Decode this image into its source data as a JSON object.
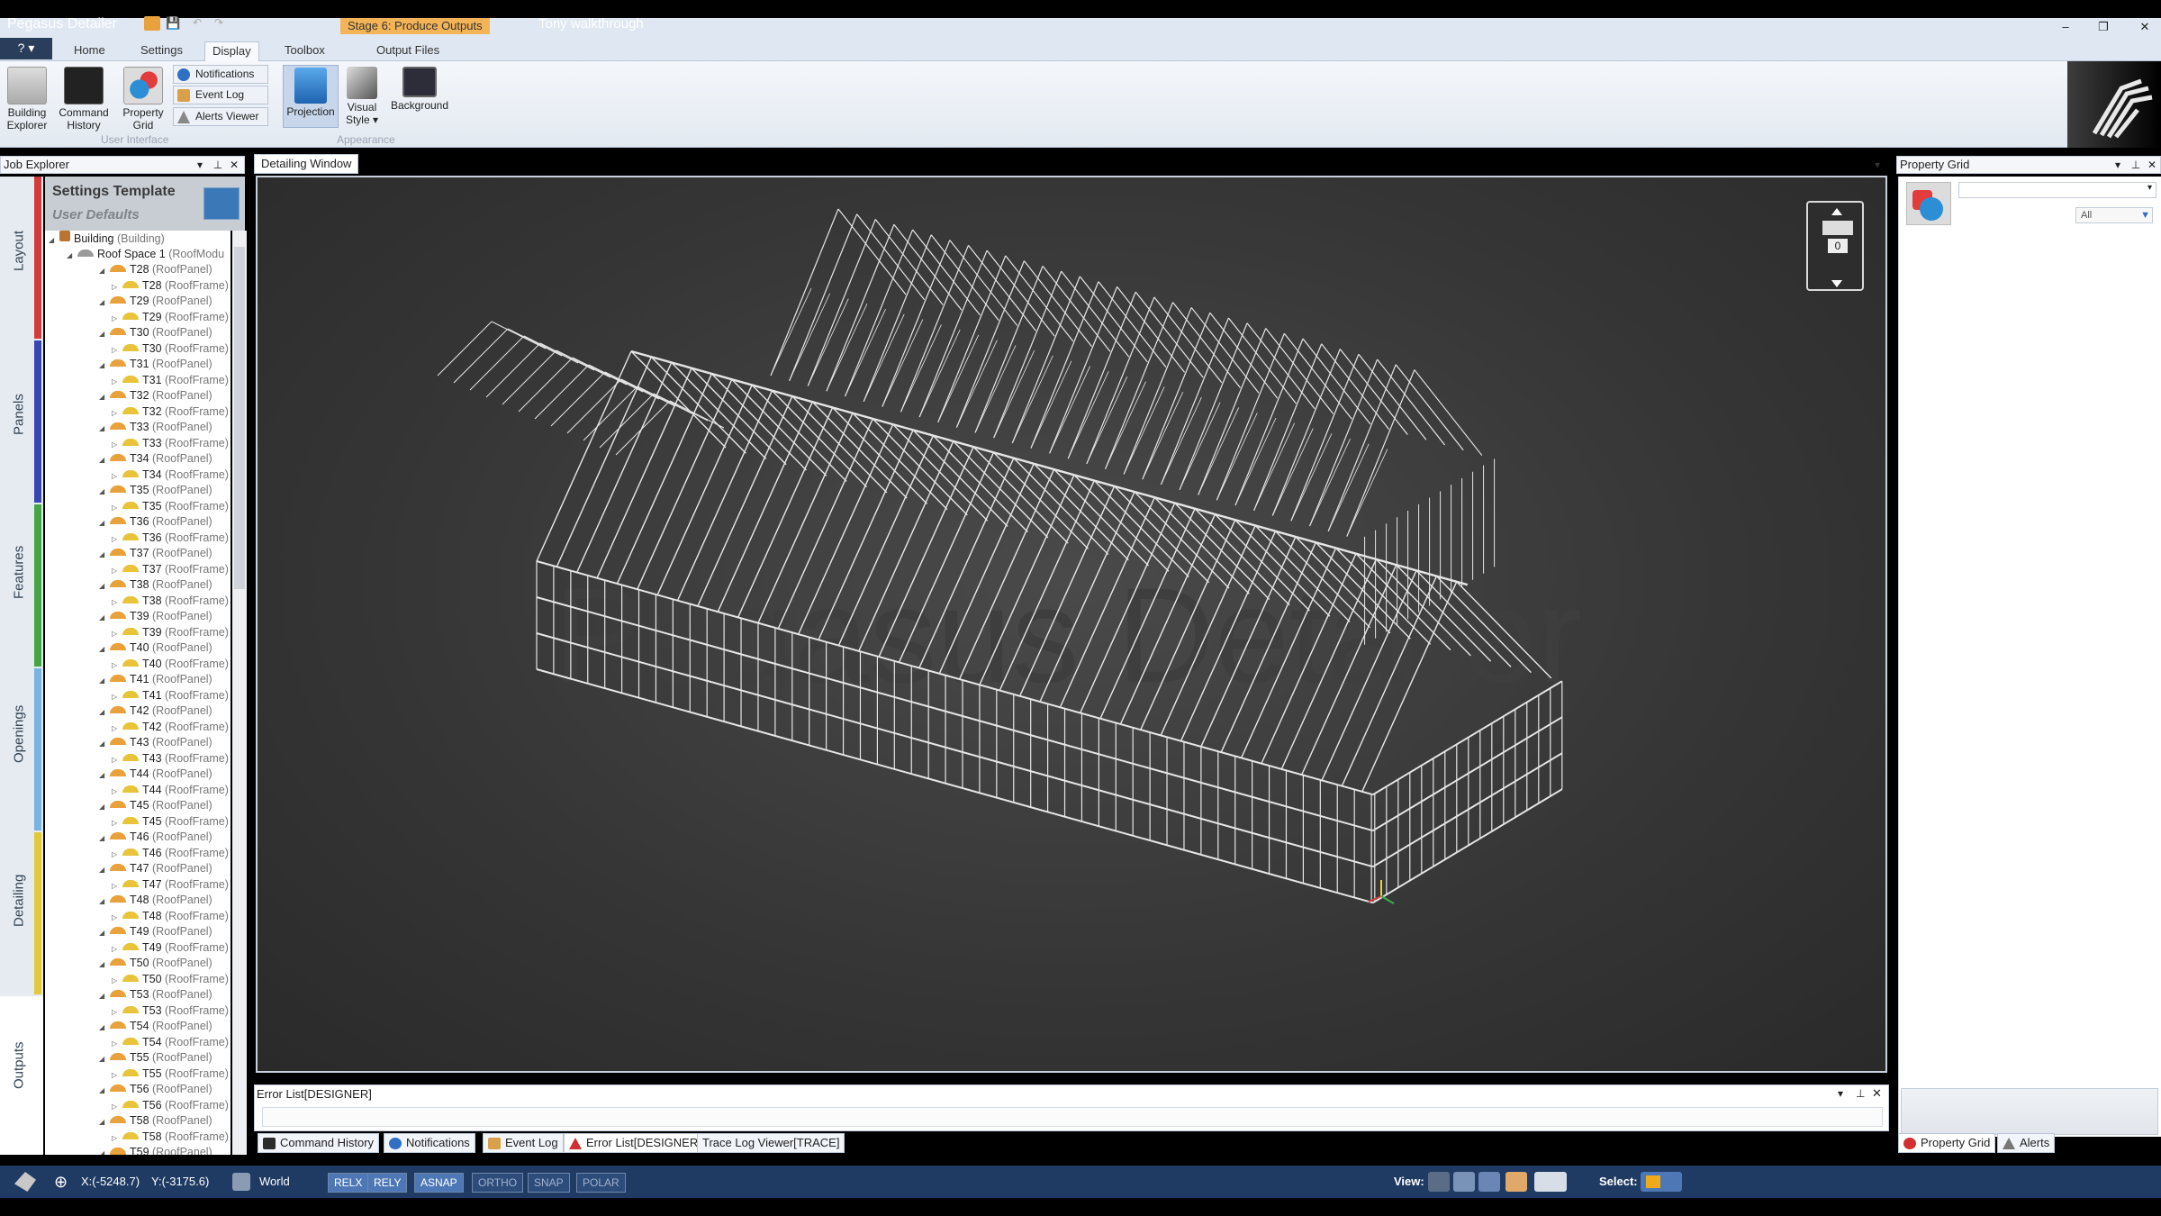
{
  "window": {
    "app_title": "Pegasus Detailer",
    "stage_label": "Stage 6: Produce Outputs",
    "document_title": "Tony walkthrough",
    "minimize": "–",
    "maximize": "❐",
    "close": "✕"
  },
  "menu": {
    "file_button": "?",
    "tabs": [
      "Home",
      "Settings",
      "Display",
      "Toolbox",
      "Output Files"
    ],
    "active_tab": "Display"
  },
  "ribbon": {
    "user_interface": {
      "group_label": "User Interface",
      "building_explorer": "Building\nExplorer",
      "command_history": "Command\nHistory",
      "property_grid": "Property\nGrid",
      "notifications": "Notifications",
      "event_log": "Event Log",
      "alerts_viewer": "Alerts Viewer"
    },
    "appearance": {
      "group_label": "Appearance",
      "projection": "Projection",
      "visual_style": "Visual\nStyle ▾",
      "background": "Background"
    }
  },
  "job_explorer": {
    "title": "Job Explorer",
    "settings_template": "Settings Template",
    "user_defaults": "User Defaults",
    "side_tabs": [
      {
        "label": "Layout",
        "color": "#d23b3b"
      },
      {
        "label": "Panels",
        "color": "#3a46b0"
      },
      {
        "label": "Features",
        "color": "#44a644"
      },
      {
        "label": "Openings",
        "color": "#78b4e0"
      },
      {
        "label": "Detailing",
        "color": "#e2c93a"
      },
      {
        "label": "Outputs",
        "color": "#ffffff"
      }
    ],
    "tree": {
      "building": "Building",
      "building_type": "(Building)",
      "roof_space": "Roof Space 1",
      "roof_space_type": "(RoofModu",
      "panel_type": "(RoofPanel)",
      "frame_type": "(RoofFrame)",
      "items": [
        "T28",
        "T29",
        "T30",
        "T31",
        "T32",
        "T33",
        "T34",
        "T35",
        "T36",
        "T37",
        "T38",
        "T39",
        "T40",
        "T41",
        "T42",
        "T43",
        "T44",
        "T45",
        "T46",
        "T47",
        "T48",
        "T49",
        "T50",
        "T53",
        "T54",
        "T55",
        "T56",
        "T58",
        "T59"
      ]
    }
  },
  "detailing_window": {
    "tab_label": "Detailing Window",
    "navcube_value": "0",
    "watermark": "Pegasus Detailer"
  },
  "error_list": {
    "title": "Error List[DESIGNER]"
  },
  "bottom_tabs": [
    {
      "label": "Command History",
      "icon": "command-history-icon",
      "color": "#2b2b2b"
    },
    {
      "label": "Notifications",
      "icon": "info-icon",
      "color": "#2f6fc4"
    },
    {
      "label": "Event Log",
      "icon": "event-log-icon",
      "color": "#d9a04a"
    },
    {
      "label": "Error List[DESIGNER]",
      "icon": "warning-icon",
      "color": "#d03030"
    },
    {
      "label": "Trace Log Viewer[TRACE]",
      "icon": "",
      "color": ""
    }
  ],
  "property_grid": {
    "title": "Property Grid",
    "filter": "All",
    "tabs": [
      "Property Grid",
      "Alerts"
    ]
  },
  "status_bar": {
    "x_coord": "X:(-5248.7)",
    "y_coord": "Y:(-3175.6)",
    "world": "World",
    "toggles": [
      {
        "label": "RELX",
        "on": true
      },
      {
        "label": "RELY",
        "on": true
      },
      {
        "label": "ASNAP",
        "on": true
      },
      {
        "label": "ORTHO",
        "on": false
      },
      {
        "label": "SNAP",
        "on": false
      },
      {
        "label": "POLAR",
        "on": false
      }
    ],
    "view_label": "View:",
    "select_label": "Select:"
  },
  "colors": {
    "accent": "#1f3a63",
    "stage_highlight": "#f3b457",
    "roof_icon": "#e8a13b"
  }
}
